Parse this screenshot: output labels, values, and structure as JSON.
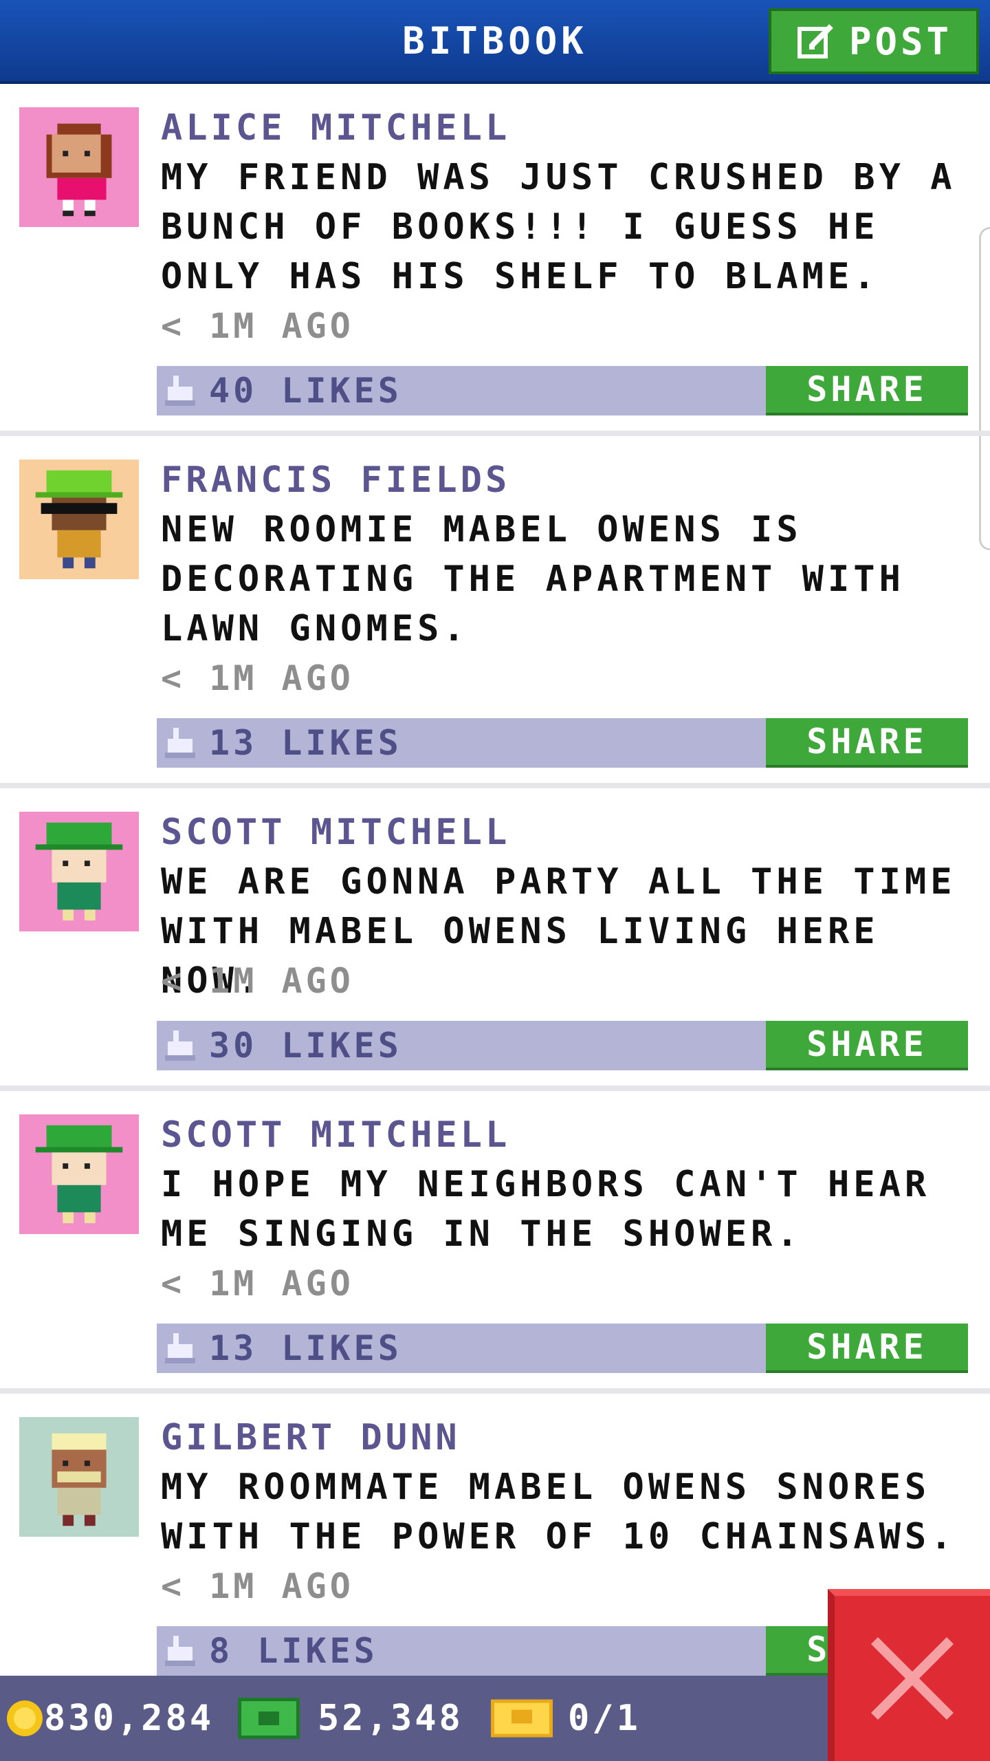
{
  "header": {
    "title": "BITBOOK",
    "post_label": "POST"
  },
  "posts": [
    {
      "author": "ALICE MITCHELL",
      "text": "MY FRIEND WAS JUST CRUSHED BY A BUNCH OF BOOKS!!! I GUESS HE ONLY HAS HIS SHELF TO BLAME.",
      "time": "< 1M AGO",
      "likes": "40 LIKES",
      "share": "SHARE",
      "avatar_bg": "#f28ec8"
    },
    {
      "author": "FRANCIS FIELDS",
      "text": "NEW ROOMIE MABEL OWENS IS DECORATING THE APARTMENT WITH LAWN GNOMES.",
      "time": "< 1M AGO",
      "likes": "13 LIKES",
      "share": "SHARE",
      "avatar_bg": "#f8cf9c"
    },
    {
      "author": "SCOTT MITCHELL",
      "text": "WE ARE GONNA PARTY ALL THE TIME WITH MABEL OWENS LIVING HERE NOW.",
      "time": "< 1M AGO",
      "likes": "30 LIKES",
      "share": "SHARE",
      "avatar_bg": "#f28ec8"
    },
    {
      "author": "SCOTT MITCHELL",
      "text": "I HOPE MY NEIGHBORS CAN'T HEAR ME SINGING IN THE SHOWER.",
      "time": "< 1M AGO",
      "likes": "13 LIKES",
      "share": "SHARE",
      "avatar_bg": "#f28ec8"
    },
    {
      "author": "GILBERT DUNN",
      "text": "MY ROOMMATE MABEL OWENS SNORES WITH THE POWER OF 10 CHAINSAWS.",
      "time": "< 1M AGO",
      "likes": "8 LIKES",
      "share": "SHARE",
      "avatar_bg": "#b5d6c8"
    }
  ],
  "status_bar": {
    "coins": "830,284",
    "bux": "52,348",
    "tickets": "0/1"
  },
  "icons": {
    "post": "compose-icon",
    "like": "thumbs-up-icon",
    "coin": "coin-icon",
    "bux": "bux-bill-icon",
    "ticket": "ticket-icon",
    "close": "close-icon"
  },
  "colors": {
    "header": "#1a54b8",
    "share": "#3fa83a",
    "like_bar": "#b3b4d6",
    "close": "#df2c34"
  }
}
